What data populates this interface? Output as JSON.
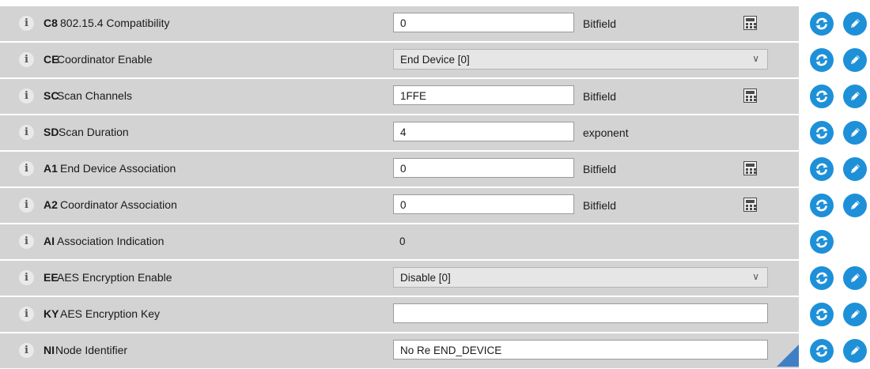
{
  "rows": [
    {
      "code": "C8",
      "label": "802.15.4 Compatibility",
      "kind": "input",
      "value": "0",
      "unit": "Bitfield",
      "calc": true,
      "read": true,
      "write": true
    },
    {
      "code": "CE",
      "label": "Coordinator Enable",
      "kind": "select",
      "value": "End Device [0]",
      "read": true,
      "write": true
    },
    {
      "code": "SC",
      "label": "Scan Channels",
      "kind": "input",
      "value": "1FFE",
      "unit": "Bitfield",
      "calc": true,
      "read": true,
      "write": true
    },
    {
      "code": "SD",
      "label": "Scan Duration",
      "kind": "input",
      "value": "4",
      "unit": "exponent",
      "calc": false,
      "read": true,
      "write": true
    },
    {
      "code": "A1",
      "label": "End Device Association",
      "kind": "input",
      "value": "0",
      "unit": "Bitfield",
      "calc": true,
      "read": true,
      "write": true
    },
    {
      "code": "A2",
      "label": "Coordinator Association",
      "kind": "input",
      "value": "0",
      "unit": "Bitfield",
      "calc": true,
      "read": true,
      "write": true
    },
    {
      "code": "AI",
      "label": "Association Indication",
      "kind": "readonly",
      "value": "0",
      "read": true,
      "write": false
    },
    {
      "code": "EE",
      "label": "AES Encryption Enable",
      "kind": "select",
      "value": "Disable [0]",
      "read": true,
      "write": true
    },
    {
      "code": "KY",
      "label": "AES Encryption Key",
      "kind": "input-wide",
      "value": "",
      "read": true,
      "write": true
    },
    {
      "code": "NI",
      "label": "Node Identifier",
      "kind": "input-wide",
      "value": "No Re END_DEVICE",
      "read": true,
      "write": true
    }
  ],
  "icons": {
    "info": "i",
    "read": "refresh-icon",
    "write": "pencil-icon",
    "calc": "calculator-icon",
    "dropdown": "chevron-down-icon"
  },
  "colors": {
    "row_bg": "#d3d3d3",
    "action_blue": "#1e90d8",
    "corner": "#3f7fc6"
  }
}
